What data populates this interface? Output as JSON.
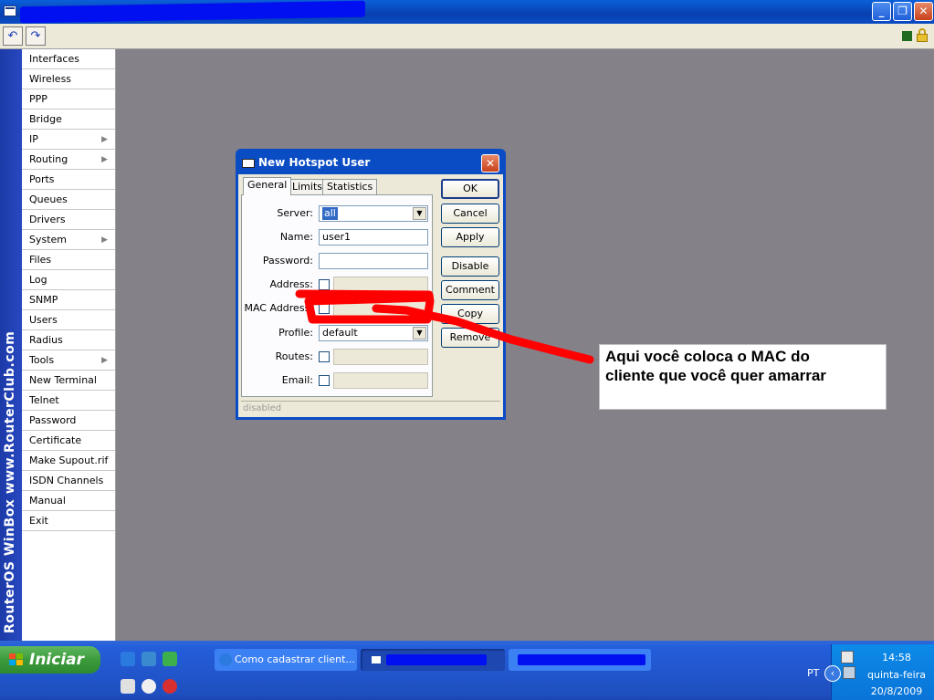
{
  "window": {
    "icons": {
      "app": "window-icon",
      "minimize": "minimize-icon",
      "maximize": "maximize-icon",
      "close": "close-icon"
    }
  },
  "toolbar": {
    "undo_icon": "↶",
    "redo_icon": "↷"
  },
  "sidestrip": {
    "text": "RouterOS WinBox   www.RouterClub.com"
  },
  "menu": {
    "items": [
      {
        "label": "Interfaces",
        "submenu": false
      },
      {
        "label": "Wireless",
        "submenu": false
      },
      {
        "label": "PPP",
        "submenu": false
      },
      {
        "label": "Bridge",
        "submenu": false
      },
      {
        "label": "IP",
        "submenu": true
      },
      {
        "label": "Routing",
        "submenu": true
      },
      {
        "label": "Ports",
        "submenu": false
      },
      {
        "label": "Queues",
        "submenu": false
      },
      {
        "label": "Drivers",
        "submenu": false
      },
      {
        "label": "System",
        "submenu": true
      },
      {
        "label": "Files",
        "submenu": false
      },
      {
        "label": "Log",
        "submenu": false
      },
      {
        "label": "SNMP",
        "submenu": false
      },
      {
        "label": "Users",
        "submenu": false
      },
      {
        "label": "Radius",
        "submenu": false
      },
      {
        "label": "Tools",
        "submenu": true
      },
      {
        "label": "New Terminal",
        "submenu": false
      },
      {
        "label": "Telnet",
        "submenu": false
      },
      {
        "label": "Password",
        "submenu": false
      },
      {
        "label": "Certificate",
        "submenu": false
      },
      {
        "label": "Make Supout.rif",
        "submenu": false
      },
      {
        "label": "ISDN Channels",
        "submenu": false
      },
      {
        "label": "Manual",
        "submenu": false
      },
      {
        "label": "Exit",
        "submenu": false
      }
    ]
  },
  "dialog": {
    "title": "New Hotspot User",
    "tabs": [
      {
        "label": "General",
        "active": true
      },
      {
        "label": "Limits"
      },
      {
        "label": "Statistics"
      }
    ],
    "fields": {
      "server": {
        "label": "Server:",
        "value": "all"
      },
      "name": {
        "label": "Name:",
        "value": "user1"
      },
      "password": {
        "label": "Password:",
        "value": ""
      },
      "address": {
        "label": "Address:",
        "value": ""
      },
      "mac": {
        "label": "MAC Address:",
        "value": ""
      },
      "profile": {
        "label": "Profile:",
        "value": "default"
      },
      "routes": {
        "label": "Routes:",
        "value": ""
      },
      "email": {
        "label": "Email:",
        "value": ""
      }
    },
    "buttons": {
      "ok": "OK",
      "cancel": "Cancel",
      "apply": "Apply",
      "disable": "Disable",
      "comment": "Comment",
      "copy": "Copy",
      "remove": "Remove"
    },
    "status": "disabled"
  },
  "annotation": {
    "line1": "Aqui você coloca o MAC do",
    "line2": "cliente que você quer amarrar",
    "highlight_color": "#ff0000"
  },
  "taskbar": {
    "start_label": "Iniciar",
    "tasks": [
      {
        "label": "Como cadastrar client..."
      }
    ],
    "language": "PT",
    "clock": {
      "time": "14:58",
      "day": "quinta-feira",
      "date": "20/8/2009"
    }
  }
}
